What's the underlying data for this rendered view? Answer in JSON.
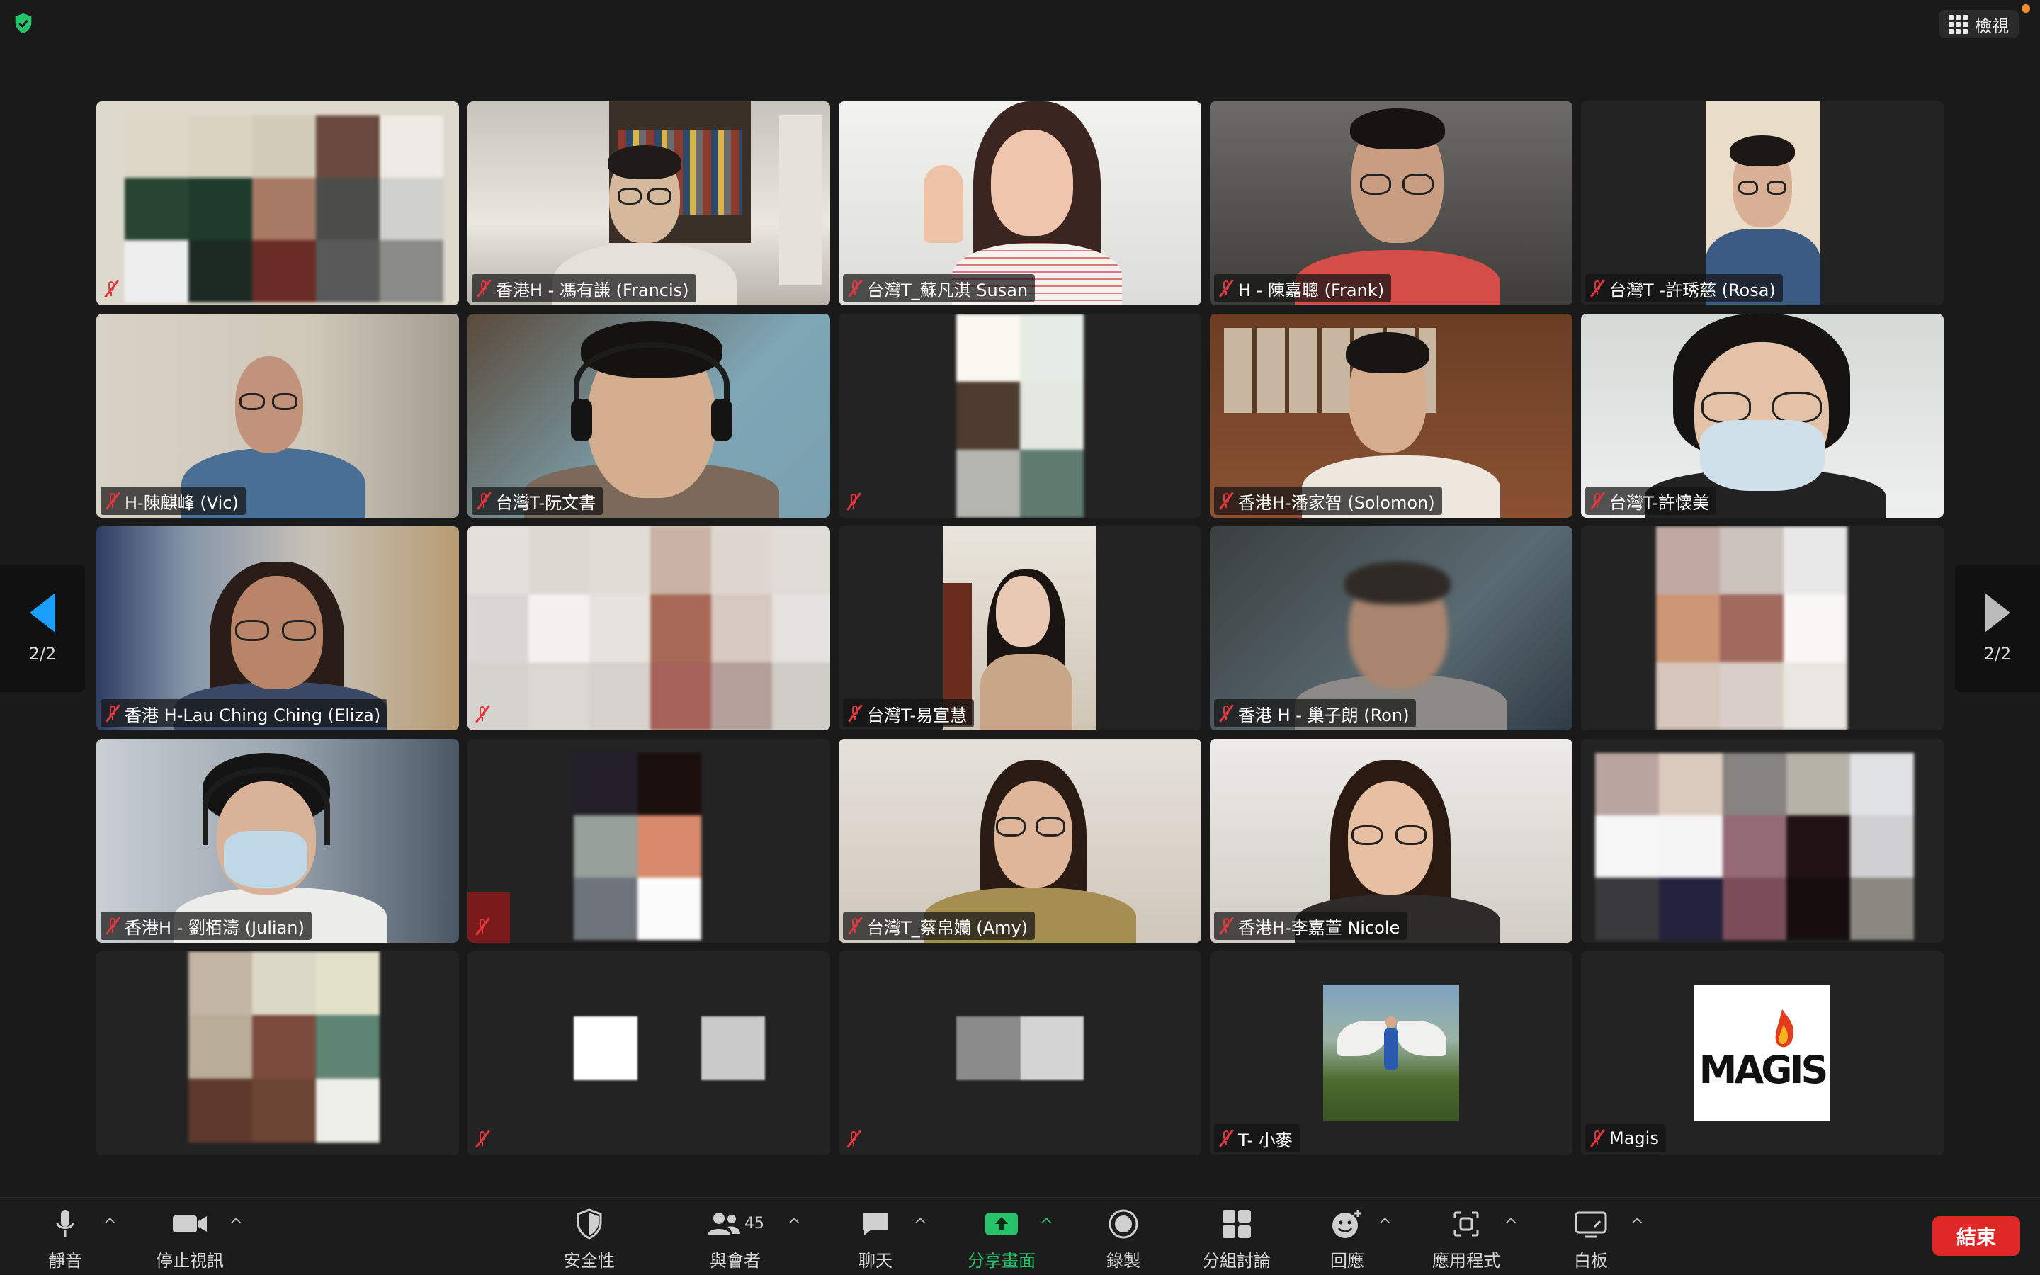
{
  "top_bar": {
    "view_label": "檢視"
  },
  "pagination": {
    "left_label": "2/2",
    "right_label": "2/2"
  },
  "participants": [
    {
      "name": ""
    },
    {
      "name": "香港H - 馮有謙 (Francis)"
    },
    {
      "name": "台灣T_蘇凡淇 Susan"
    },
    {
      "name": "H - 陳嘉聰  (Frank)"
    },
    {
      "name": "台灣T -許琇慈 (Rosa)"
    },
    {
      "name": "H-陳麒峰 (Vic)"
    },
    {
      "name": "台灣T-阮文書"
    },
    {
      "name": ""
    },
    {
      "name": "香港H-潘家智 (Solomon)"
    },
    {
      "name": "台灣T-許懷美"
    },
    {
      "name": "香港 H-Lau Ching Ching (Eliza)"
    },
    {
      "name": ""
    },
    {
      "name": "台灣T-易宣慧"
    },
    {
      "name": "香港 H - 巢子朗 (Ron)"
    },
    {
      "name": ""
    },
    {
      "name": "香港H - 劉栢濤 (Julian)"
    },
    {
      "name": ""
    },
    {
      "name": "台灣T_蔡帛孏 (Amy)"
    },
    {
      "name": "香港H-李嘉萱 Nicole"
    },
    {
      "name": ""
    },
    {
      "name": ""
    },
    {
      "name": ""
    },
    {
      "name": ""
    },
    {
      "name": "T- 小麥"
    },
    {
      "name": "Magis"
    }
  ],
  "magis_logo_text": "MAGIS",
  "toolbar": {
    "mute": "靜音",
    "stop_video": "停止視訊",
    "security": "安全性",
    "participants": "與會者",
    "participants_count": "45",
    "chat": "聊天",
    "share_screen": "分享畫面",
    "record": "錄製",
    "breakout": "分組討論",
    "reactions": "回應",
    "apps": "應用程式",
    "whiteboard": "白板",
    "end": "結束"
  },
  "colors": {
    "background": "#1a1a1a",
    "muted_red": "#e0383e",
    "share_green": "#27c36a",
    "end_red": "#e02828",
    "arrow_blue": "#1a9fff"
  }
}
